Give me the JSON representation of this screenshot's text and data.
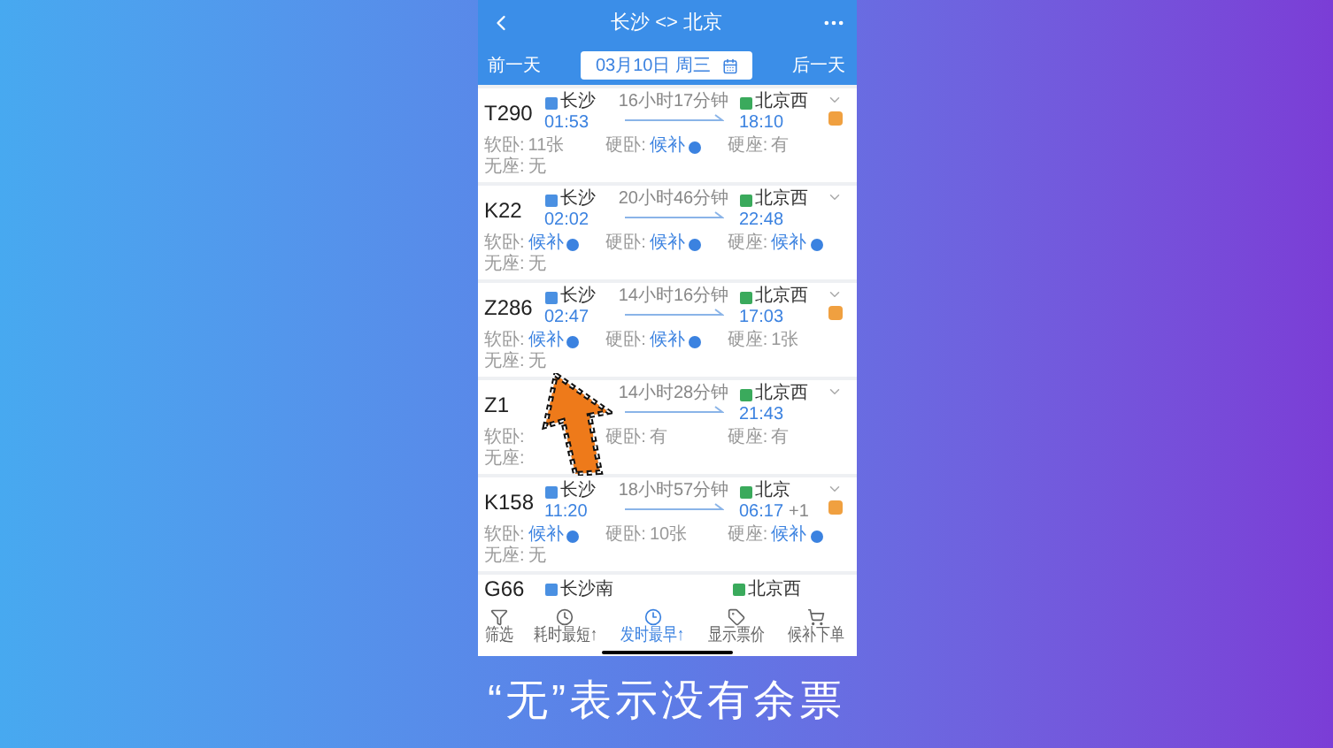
{
  "header": {
    "title": "长沙 <> 北京"
  },
  "date_bar": {
    "prev": "前一天",
    "date": "03月10日 周三",
    "next": "后一天"
  },
  "trains": [
    {
      "number": "T290",
      "from": "长沙",
      "depart": "01:53",
      "duration": "16小时17分钟",
      "to": "北京西",
      "arrive": "18:10",
      "badge": true,
      "seats": [
        {
          "label": "软卧:",
          "value": "11张",
          "kind": "text"
        },
        {
          "label": "硬卧:",
          "value": "候补",
          "kind": "waitlist"
        },
        {
          "label": "硬座:",
          "value": "有",
          "kind": "text"
        },
        {
          "label": "无座:",
          "value": "无",
          "kind": "text"
        }
      ]
    },
    {
      "number": "K22",
      "from": "长沙",
      "depart": "02:02",
      "duration": "20小时46分钟",
      "to": "北京西",
      "arrive": "22:48",
      "badge": false,
      "seats": [
        {
          "label": "软卧:",
          "value": "候补",
          "kind": "waitlist"
        },
        {
          "label": "硬卧:",
          "value": "候补",
          "kind": "waitlist"
        },
        {
          "label": "硬座:",
          "value": "候补",
          "kind": "waitlist"
        },
        {
          "label": "无座:",
          "value": "无",
          "kind": "text"
        }
      ]
    },
    {
      "number": "Z286",
      "from": "长沙",
      "depart": "02:47",
      "duration": "14小时16分钟",
      "to": "北京西",
      "arrive": "17:03",
      "badge": true,
      "seats": [
        {
          "label": "软卧:",
          "value": "候补",
          "kind": "waitlist"
        },
        {
          "label": "硬卧:",
          "value": "候补",
          "kind": "waitlist"
        },
        {
          "label": "硬座:",
          "value": "1张",
          "kind": "text"
        },
        {
          "label": "无座:",
          "value": "无",
          "kind": "text"
        }
      ]
    },
    {
      "number": "Z1",
      "duration": "14小时28分钟",
      "to": "北京西",
      "arrive": "21:43",
      "badge": false,
      "pointer": true,
      "seats": [
        {
          "label": "软卧:"
        },
        {
          "label": "硬卧:",
          "value": "有",
          "kind": "text"
        },
        {
          "label": "硬座:",
          "value": "有",
          "kind": "text"
        },
        {
          "label": "无座:"
        }
      ]
    },
    {
      "number": "K158",
      "from": "长沙",
      "depart": "11:20",
      "duration": "18小时57分钟",
      "to": "北京",
      "arrive": "06:17",
      "arrive_note": "+1",
      "badge": true,
      "seats": [
        {
          "label": "软卧:",
          "value": "候补",
          "kind": "waitlist"
        },
        {
          "label": "硬卧:",
          "value": "10张",
          "kind": "text"
        },
        {
          "label": "硬座:",
          "value": "候补",
          "kind": "waitlist"
        },
        {
          "label": "无座:",
          "value": "无",
          "kind": "text"
        }
      ]
    }
  ],
  "next_train": {
    "number": "G66",
    "from": "长沙南",
    "to": "北京西"
  },
  "bottom_bar": [
    {
      "label": "筛选",
      "selected": false
    },
    {
      "label": "耗时最短↑",
      "selected": false
    },
    {
      "label": "发时最早↑",
      "selected": true
    },
    {
      "label": "显示票价",
      "selected": false
    },
    {
      "label": "候补下单",
      "selected": false
    }
  ],
  "caption": "“无”表示没有余票"
}
